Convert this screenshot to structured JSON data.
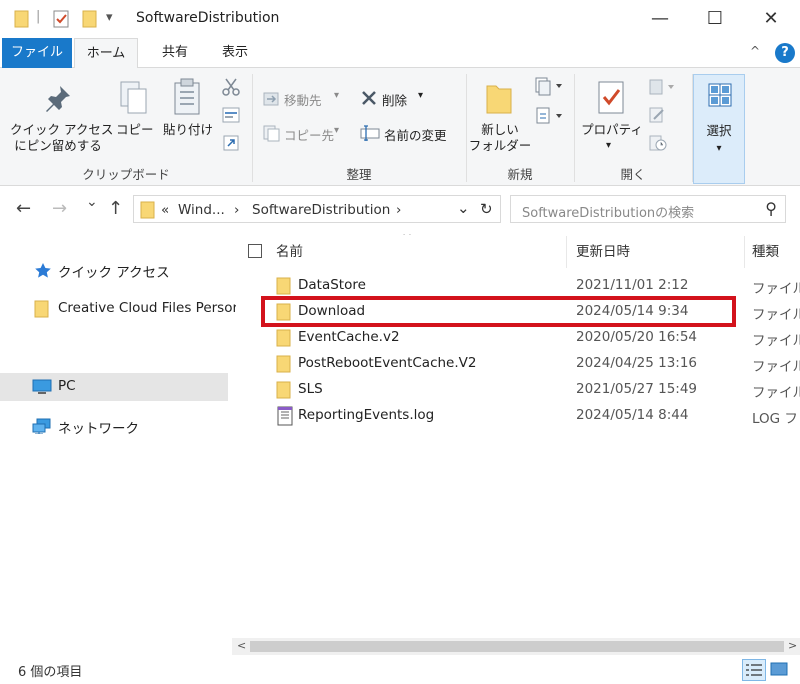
{
  "window": {
    "title": "SoftwareDistribution",
    "minimize": "—",
    "maximize": "☐",
    "close": "✕",
    "qat_separator": "|",
    "qat_dropdown": "▾"
  },
  "ribbon_tabs": {
    "file": "ファイル",
    "home": "ホーム",
    "share": "共有",
    "view": "表示",
    "collapse": "^",
    "help": "?"
  },
  "ribbon": {
    "clipboard": {
      "pin_label_1": "クイック アクセス",
      "pin_label_2": "にピン留めする",
      "copy": "コピー",
      "paste": "貼り付け",
      "group": "クリップボード"
    },
    "organize": {
      "move_to": "移動先",
      "copy_to": "コピー先",
      "delete": "削除",
      "rename": "名前の変更",
      "group": "整理"
    },
    "new": {
      "new_folder_1": "新しい",
      "new_folder_2": "フォルダー",
      "group": "新規"
    },
    "open": {
      "properties": "プロパティ",
      "group": "開く"
    },
    "select": {
      "select": "選択"
    }
  },
  "address": {
    "back": "←",
    "forward": "→",
    "recent": "⌄",
    "up": "↑",
    "crumb_overflow": "«",
    "crumb_1": "Wind...",
    "crumb_sep": "›",
    "crumb_2": "SoftwareDistribution",
    "dropdown": "⌄",
    "refresh": "↻"
  },
  "search": {
    "placeholder": "SoftwareDistributionの検索",
    "icon": "⚲"
  },
  "nav_pane": {
    "items": [
      {
        "label": "クイック アクセス",
        "icon": "star-icon"
      },
      {
        "label": "Creative Cloud Files Persor",
        "icon": "folder-icon"
      },
      {
        "label": "PC",
        "icon": "computer-icon",
        "selected": true
      },
      {
        "label": "ネットワーク",
        "icon": "network-icon"
      }
    ]
  },
  "file_list": {
    "sort_indicator": "^",
    "columns": {
      "name": "名前",
      "date": "更新日時",
      "type": "種類"
    },
    "rows": [
      {
        "name": "DataStore",
        "date": "2021/11/01 2:12",
        "type": "ファイル フ",
        "icon": "folder-icon"
      },
      {
        "name": "Download",
        "date": "2024/05/14 9:34",
        "type": "ファイル フ",
        "icon": "folder-icon",
        "highlighted": true
      },
      {
        "name": "EventCache.v2",
        "date": "2020/05/20 16:54",
        "type": "ファイル フ",
        "icon": "folder-icon"
      },
      {
        "name": "PostRebootEventCache.V2",
        "date": "2024/04/25 13:16",
        "type": "ファイル フ",
        "icon": "folder-icon"
      },
      {
        "name": "SLS",
        "date": "2021/05/27 15:49",
        "type": "ファイル フ",
        "icon": "folder-icon"
      },
      {
        "name": "ReportingEvents.log",
        "date": "2024/05/14 8:44",
        "type": "LOG ファ",
        "icon": "log-file-icon"
      }
    ]
  },
  "scrollbar": {
    "left": "<",
    "right": ">"
  },
  "status": {
    "count": "6 個の項目"
  },
  "colors": {
    "accent": "#1979ca",
    "folder": "#f8d775",
    "highlight_box": "#d3121c",
    "selected_nav": "#e5e5e5"
  }
}
